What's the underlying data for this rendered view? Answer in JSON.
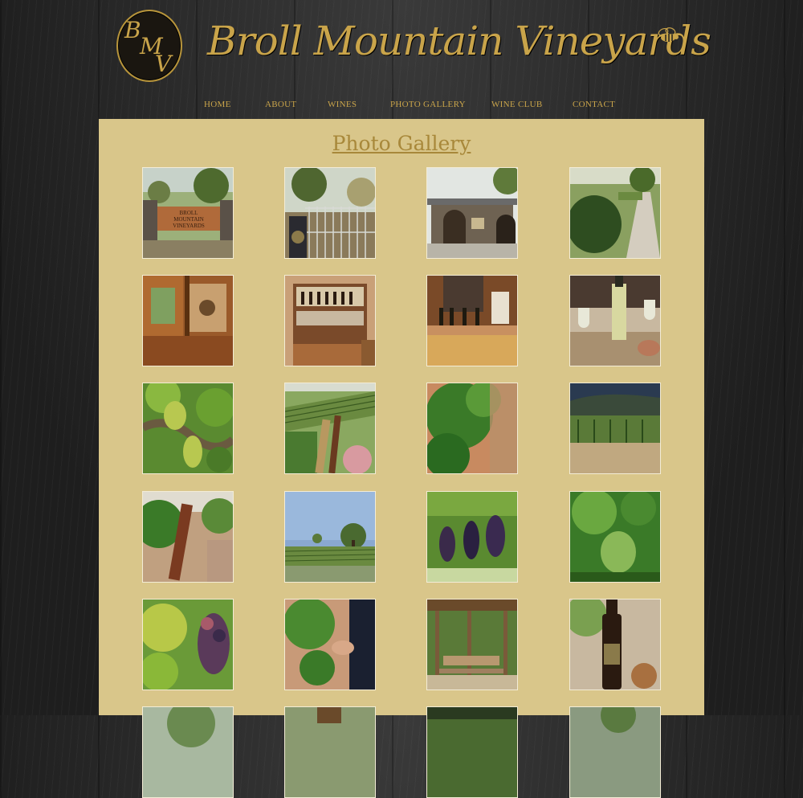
{
  "header": {
    "logo_monogram": "BMV",
    "logo_letters": [
      "B",
      "M",
      "V"
    ],
    "site_name": "Broll Mountain Vineyards"
  },
  "nav": {
    "items": [
      "HOME",
      "ABOUT",
      "WINES",
      "PHOTO GALLERY",
      "WINE CLUB",
      "CONTACT"
    ]
  },
  "main": {
    "title": "Photo Gallery",
    "gallery_sign_text": [
      "BROLL",
      "MOUNTAIN",
      "VINEYARDS"
    ]
  },
  "colors": {
    "accent_gold": "#c9a44a",
    "content_bg": "#d9c68a",
    "title_gold": "#a8883a"
  }
}
